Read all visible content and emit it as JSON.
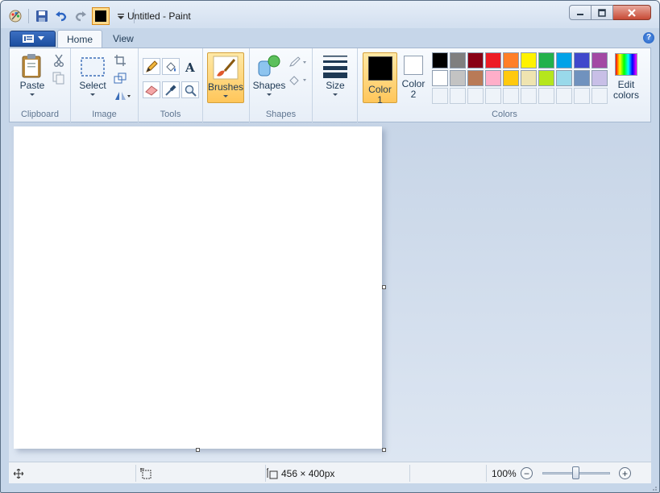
{
  "window": {
    "title": "Untitled - Paint"
  },
  "tabs": [
    {
      "label": "Home"
    },
    {
      "label": "View"
    }
  ],
  "help": {
    "label": "?"
  },
  "ribbon": {
    "clipboard": {
      "group_label": "Clipboard",
      "paste_label": "Paste"
    },
    "image": {
      "group_label": "Image",
      "select_label": "Select"
    },
    "tools": {
      "group_label": "Tools"
    },
    "brushes": {
      "label": "Brushes"
    },
    "shapes": {
      "group_label": "Shapes",
      "label": "Shapes"
    },
    "size": {
      "label": "Size"
    },
    "colors": {
      "group_label": "Colors",
      "color1_label_a": "Color",
      "color1_label_b": "1",
      "color2_label_a": "Color",
      "color2_label_b": "2",
      "edit_label_a": "Edit",
      "edit_label_b": "colors",
      "color1_value": "#000000",
      "color2_value": "#ffffff",
      "palette_row1": [
        "#000000",
        "#7f7f7f",
        "#880015",
        "#ed1c24",
        "#ff7f27",
        "#fff200",
        "#22b14c",
        "#00a2e8",
        "#3f48cc",
        "#a349a4"
      ],
      "palette_row2": [
        "#ffffff",
        "#c3c3c3",
        "#b97a57",
        "#ffaec9",
        "#ffc90e",
        "#efe4b0",
        "#b5e61d",
        "#99d9ea",
        "#7092be",
        "#c8bfe7"
      ]
    }
  },
  "status": {
    "image_size": "456 × 400px",
    "zoom": "100%"
  },
  "colors": {
    "accent": "#ffc65a",
    "ribbon_bg": "#e7eef7",
    "canvas_bg": "#ffffff",
    "workspace_bg": "#c7d5e7"
  }
}
